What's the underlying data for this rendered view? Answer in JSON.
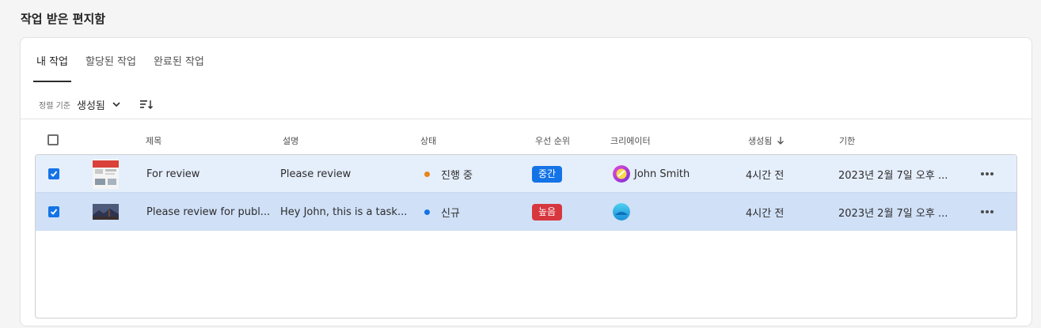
{
  "page": {
    "title": "작업 받은 편지함"
  },
  "tabs": [
    {
      "label": "내 작업",
      "active": true
    },
    {
      "label": "할당된 작업",
      "active": false
    },
    {
      "label": "완료된 작업",
      "active": false
    }
  ],
  "sort": {
    "label": "정렬 기준",
    "value": "생성됨"
  },
  "columns": {
    "title": "제목",
    "description": "설명",
    "status": "상태",
    "priority": "우선 순위",
    "creator": "크리에이터",
    "created": "생성됨",
    "due": "기한"
  },
  "rows": [
    {
      "title": "For review",
      "description": "Please review",
      "status": "진행 중",
      "status_color": "#e68619",
      "priority": "중간",
      "priority_color": "#1473e6",
      "creator": "John Smith",
      "created": "4시간 전",
      "due": "2023년 2월 7일 오후 ...",
      "selected": true
    },
    {
      "title": "Please review for publ...",
      "description": "Hey John, this is a task...",
      "status": "신규",
      "status_color": "#1473e6",
      "priority": "높음",
      "priority_color": "#d7373f",
      "creator": "",
      "created": "4시간 전",
      "due": "2023년 2월 7일 오후 ...",
      "selected": true
    }
  ]
}
